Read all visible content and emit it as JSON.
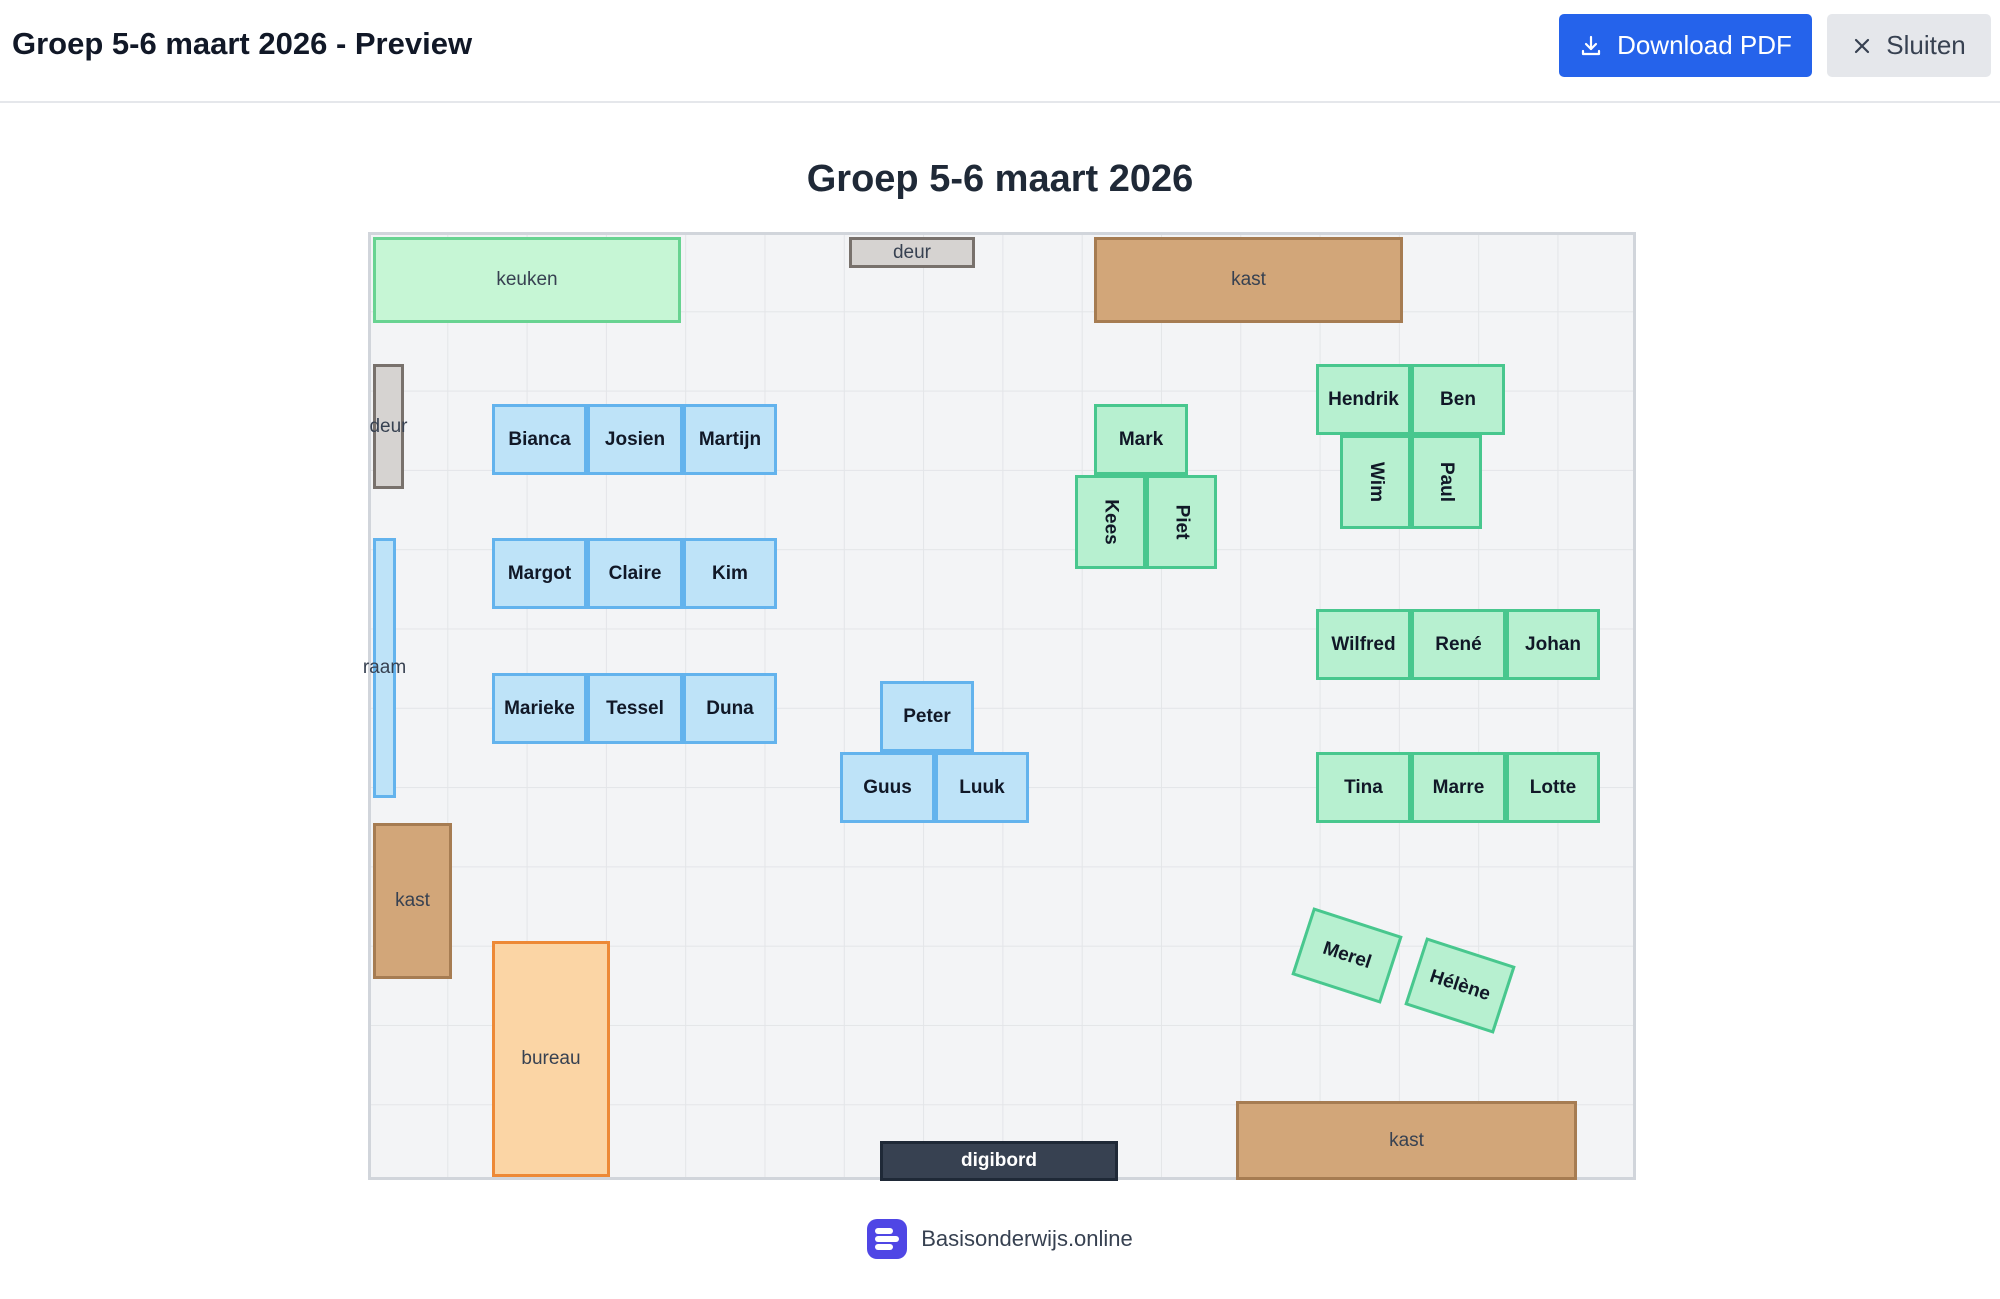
{
  "header": {
    "title": "Groep 5-6 maart 2026 - Preview",
    "download_label": "Download PDF",
    "close_label": "Sluiten"
  },
  "plan": {
    "title": "Groep 5-6 maart 2026",
    "objects": {
      "kitchen": "keuken",
      "door_top": "deur",
      "cabinet_top": "kast",
      "door_left": "deur",
      "window_left": "raam",
      "cabinet_left": "kast",
      "desk": "bureau",
      "board": "digibord",
      "cabinet_bottom": "kast"
    },
    "seats": {
      "bianca": "Bianca",
      "josien": "Josien",
      "martijn": "Martijn",
      "margot": "Margot",
      "claire": "Claire",
      "kim": "Kim",
      "marieke": "Marieke",
      "tessel": "Tessel",
      "duna": "Duna",
      "peter": "Peter",
      "guus": "Guus",
      "luuk": "Luuk",
      "mark": "Mark",
      "kees": "Kees",
      "piet": "Piet",
      "hendrik": "Hendrik",
      "ben": "Ben",
      "wim": "Wim",
      "paul": "Paul",
      "wilfred": "Wilfred",
      "rene": "René",
      "johan": "Johan",
      "tina": "Tina",
      "marre": "Marre",
      "lotte": "Lotte",
      "merel": "Merel",
      "helene": "Hélène"
    }
  },
  "footer": {
    "brand": "Basisonderwijs.online"
  },
  "colors": {
    "primary": "#2563eb",
    "seat_blue": "#bee3f8",
    "seat_green": "#b7f0d0",
    "cabinet": "#d2a679",
    "board": "#374151"
  }
}
